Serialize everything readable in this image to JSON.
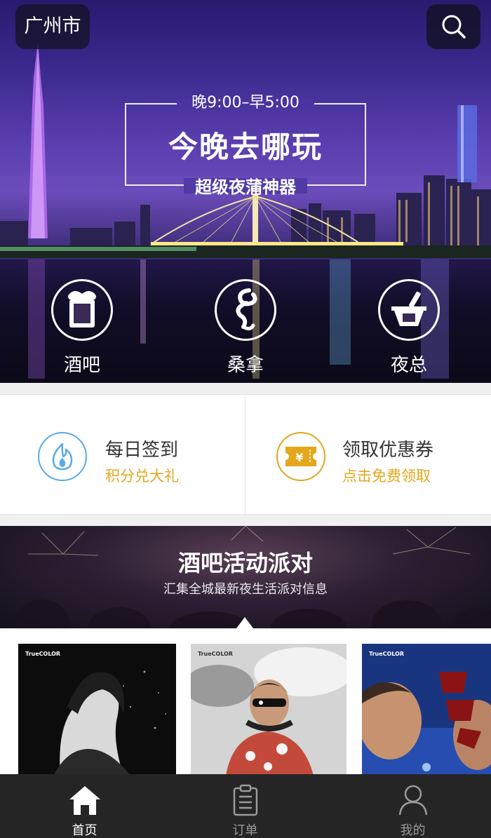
{
  "header": {
    "city": "广州市",
    "search_icon": "search-icon"
  },
  "banner": {
    "time": "晚9:00–早5:00",
    "title": "今晚去哪玩",
    "subtitle": "超级夜蒲神器"
  },
  "categories": [
    {
      "label": "酒吧",
      "icon": "beer-icon"
    },
    {
      "label": "桑拿",
      "icon": "sauna-icon"
    },
    {
      "label": "夜总",
      "icon": "cocktail-icon"
    }
  ],
  "actions": [
    {
      "title": "每日签到",
      "subtitle": "积分兑大礼",
      "icon": "flame-icon",
      "color": "#5aaae6"
    },
    {
      "title": "领取优惠券",
      "subtitle": "点击免费领取",
      "icon": "coupon-icon",
      "color": "#e3a71b"
    }
  ],
  "party": {
    "title": "酒吧活动派对",
    "subtitle": "汇集全城最新夜生活派对信息"
  },
  "posters": [
    {
      "brand": "TrueCOLOR"
    },
    {
      "brand": "TrueCOLOR"
    },
    {
      "brand": "TrueCOLOR"
    }
  ],
  "tabbar": {
    "items": [
      {
        "label": "首页",
        "icon": "home-icon",
        "active": true
      },
      {
        "label": "订单",
        "icon": "clipboard-icon",
        "active": false
      },
      {
        "label": "我的",
        "icon": "user-icon",
        "active": false
      }
    ]
  },
  "colors": {
    "accent": "#e3a71b",
    "blue": "#5aaae6",
    "tabbar": "#252525"
  }
}
